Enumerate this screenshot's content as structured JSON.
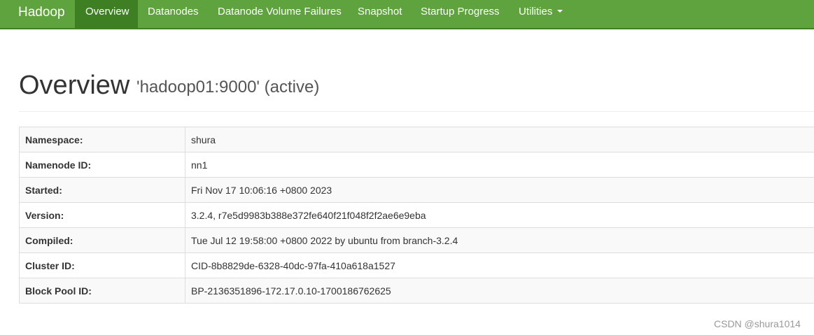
{
  "navbar": {
    "brand": "Hadoop",
    "items": [
      {
        "label": "Overview",
        "active": true
      },
      {
        "label": "Datanodes"
      },
      {
        "label": "Datanode Volume Failures"
      },
      {
        "label": "Snapshot"
      },
      {
        "label": "Startup Progress"
      },
      {
        "label": "Utilities",
        "dropdown": true
      }
    ]
  },
  "header": {
    "title": "Overview",
    "subtitle": "'hadoop01:9000' (active)"
  },
  "info_table": [
    {
      "key": "Namespace:",
      "value": "shura"
    },
    {
      "key": "Namenode ID:",
      "value": "nn1"
    },
    {
      "key": "Started:",
      "value": "Fri Nov 17 10:06:16 +0800 2023"
    },
    {
      "key": "Version:",
      "value": "3.2.4, r7e5d9983b388e372fe640f21f048f2f2ae6e9eba"
    },
    {
      "key": "Compiled:",
      "value": "Tue Jul 12 19:58:00 +0800 2022 by ubuntu from branch-3.2.4"
    },
    {
      "key": "Cluster ID:",
      "value": "CID-8b8829de-6328-40dc-97fa-410a618a1527"
    },
    {
      "key": "Block Pool ID:",
      "value": "BP-2136351896-172.17.0.10-1700186762625"
    }
  ],
  "watermark": "CSDN @shura1014",
  "colors": {
    "navbar": "#5fa33e",
    "navbar_active": "#3f7f24"
  },
  "icons": {
    "utilities_dropdown": "caret-down-icon"
  }
}
